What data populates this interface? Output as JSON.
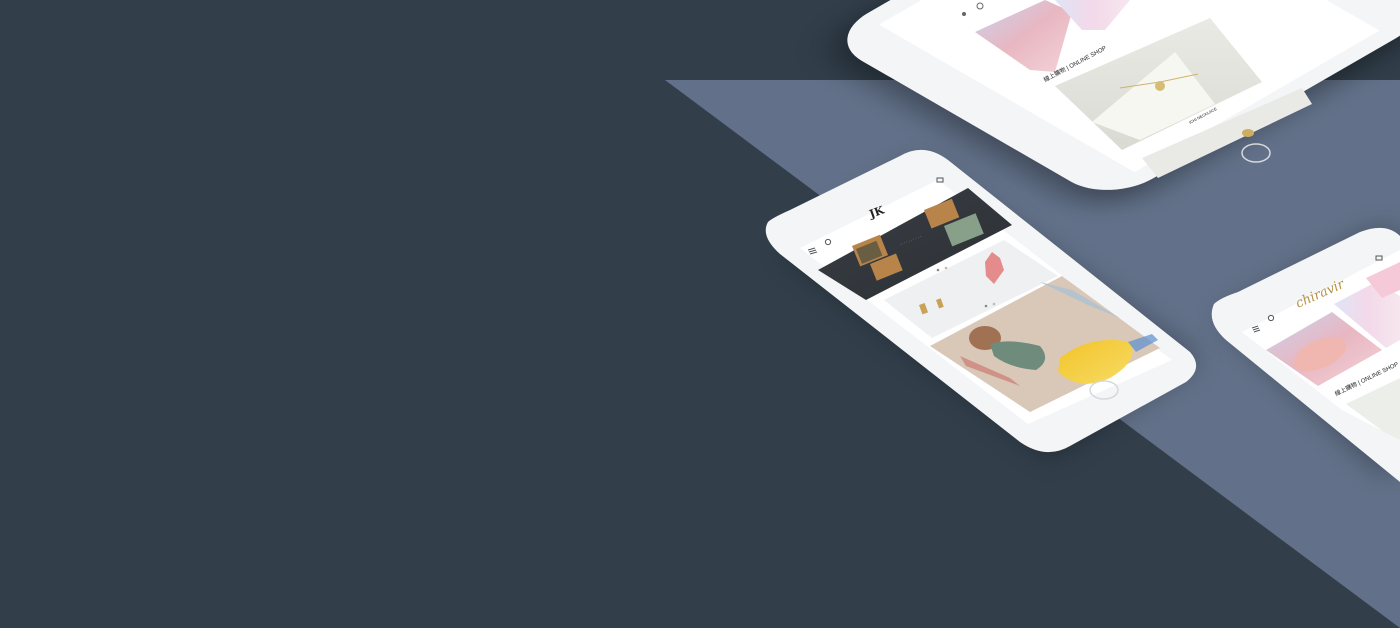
{
  "palette": {
    "background": "#323f4b",
    "accent_panel": "#627189",
    "device_body": "#f4f5f7",
    "device_screen": "#ffffff"
  },
  "devices": [
    {
      "id": "top-right",
      "screen_text": "線上購物 | ONLINE SHOP",
      "caption": "ICHI NECKLACE",
      "icons": [
        "menu-icon",
        "search-icon"
      ]
    },
    {
      "id": "center",
      "logo": "JK",
      "icons": [
        "menu-icon",
        "search-icon",
        "cart-icon"
      ]
    },
    {
      "id": "bottom-right",
      "logo": "chiravir",
      "screen_text": "線上購物 | ONLINE SHOP",
      "icons": [
        "menu-icon",
        "search-icon",
        "cart-icon"
      ]
    }
  ]
}
